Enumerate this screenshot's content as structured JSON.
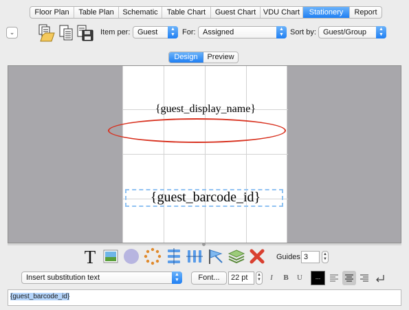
{
  "tabs": [
    {
      "label": "Floor Plan",
      "active": false
    },
    {
      "label": "Table Plan",
      "active": false
    },
    {
      "label": "Schematic",
      "active": false
    },
    {
      "label": "Table Chart",
      "active": false
    },
    {
      "label": "Guest Chart",
      "active": false
    },
    {
      "label": "VDU Chart",
      "active": false
    },
    {
      "label": "Stationery",
      "active": true
    },
    {
      "label": "Report",
      "active": false
    }
  ],
  "toolbar": {
    "collapse_glyph": "⌄",
    "item_per_label": "Item per:",
    "item_per_value": "Guest",
    "for_label": "For:",
    "for_value": "Assigned",
    "sort_by_label": "Sort by:",
    "sort_by_value": "Guest/Group"
  },
  "view_toggle": {
    "design_label": "Design",
    "preview_label": "Preview",
    "active": "Design"
  },
  "canvas": {
    "display_name_text": "{guest_display_name}",
    "barcode_text": "{guest_barcode_id}"
  },
  "tools": {
    "guides_label": "Guides:",
    "guides_value": "3"
  },
  "format_bar": {
    "substitution_placeholder": "Insert substitution text",
    "font_button_label": "Font...",
    "font_size_value": "22 pt",
    "italic_label": "I",
    "bold_label": "B",
    "underline_label": "U",
    "color_well_label": "...",
    "text_color": "#000000"
  },
  "editor": {
    "text": "{guest_barcode_id}"
  },
  "colors": {
    "accent": "#1f7ff3",
    "highlight_ellipse": "#d8311f",
    "canvas_gray": "#a8a7ab"
  }
}
